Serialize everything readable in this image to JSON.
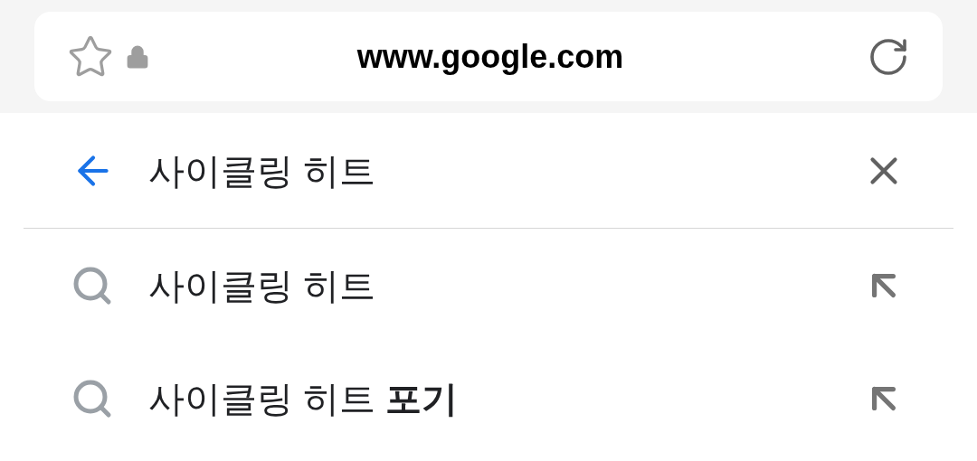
{
  "address_bar": {
    "url": "www.google.com"
  },
  "search": {
    "value": "사이클링 히트"
  },
  "suggestions": [
    {
      "text": "사이클링 히트"
    },
    {
      "text": "사이클링 히트 **포기**"
    }
  ]
}
